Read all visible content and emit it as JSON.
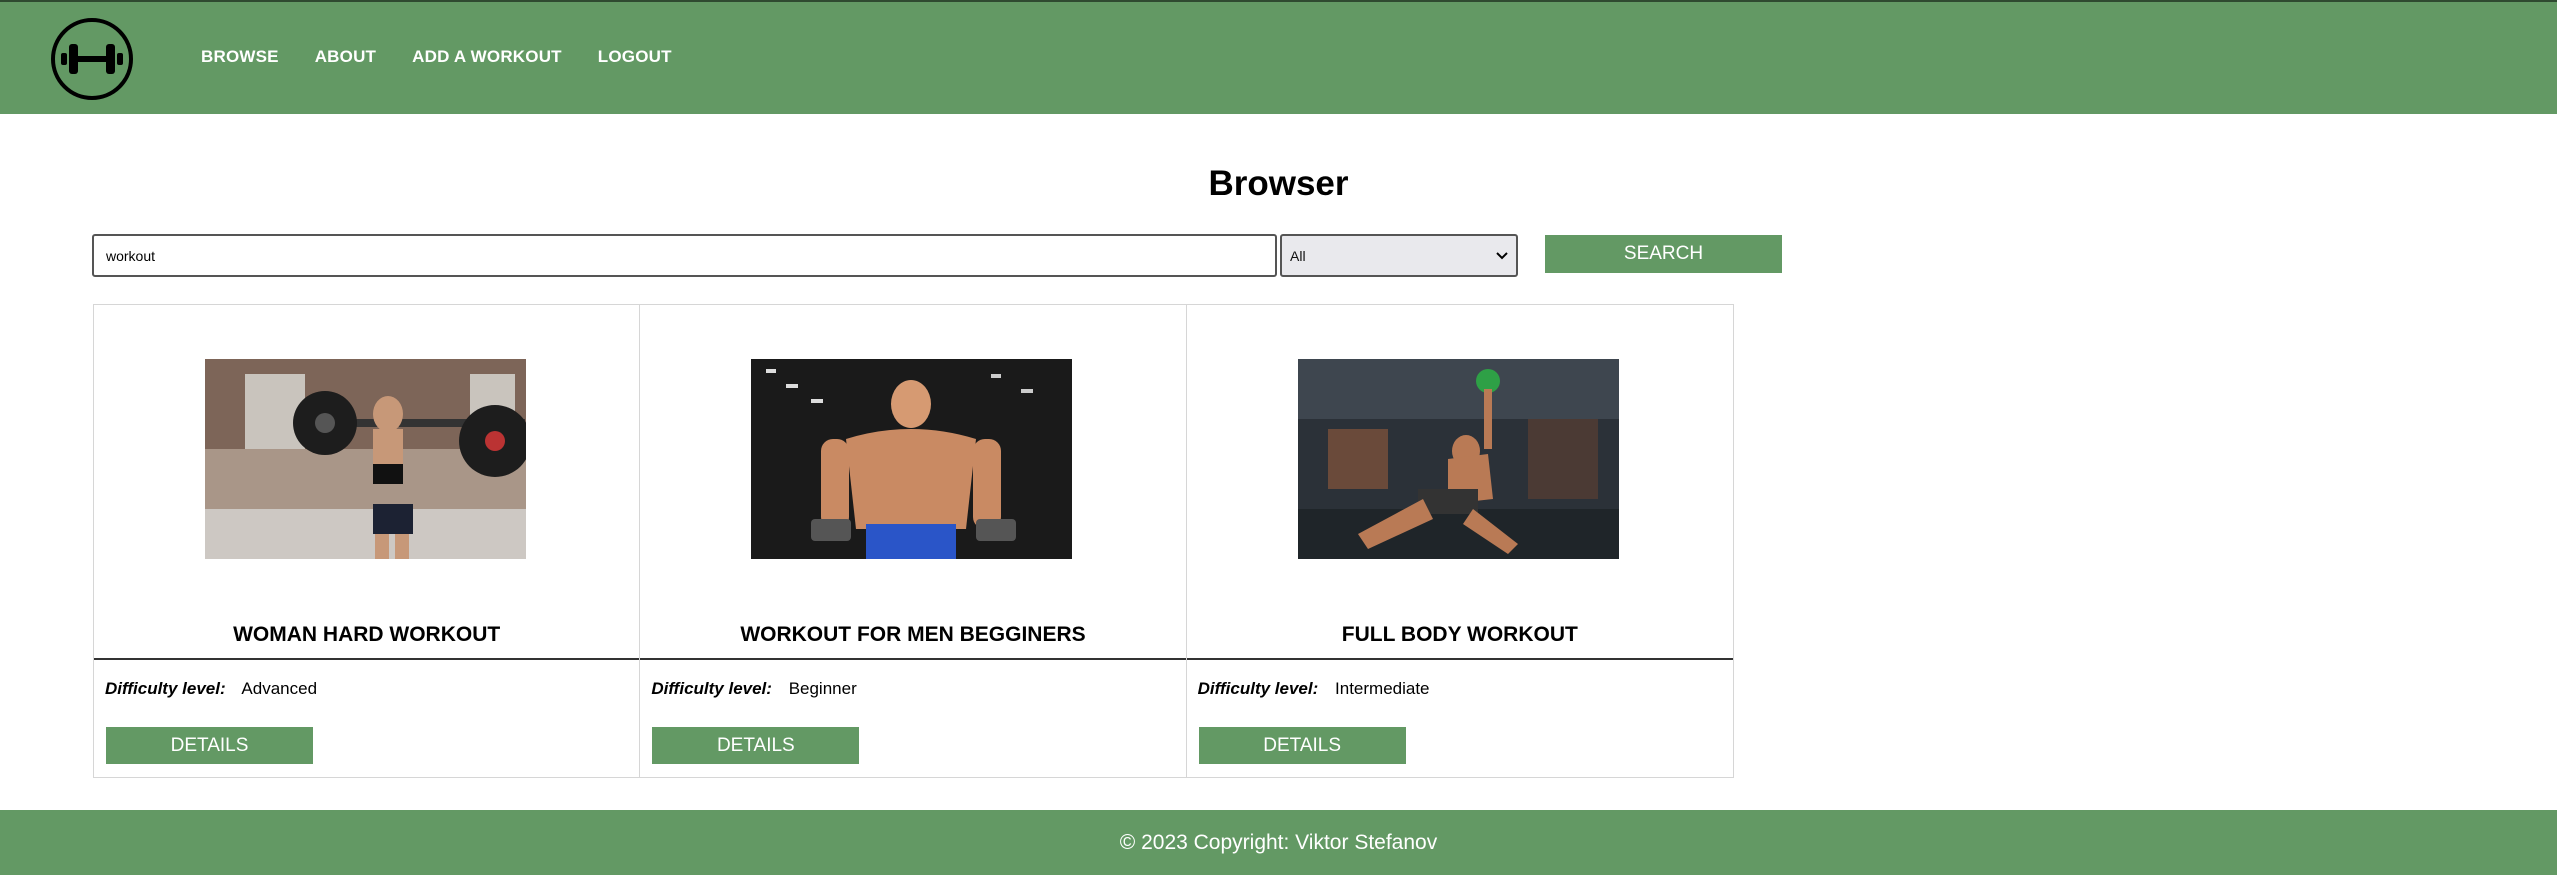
{
  "header": {
    "logo_icon": "dumbbell-icon",
    "nav": [
      "BROWSE",
      "ABOUT",
      "ADD A WORKOUT",
      "LOGOUT"
    ]
  },
  "main": {
    "title": "Browser",
    "search": {
      "value": "workout",
      "placeholder": ""
    },
    "filter": {
      "selected": "All"
    },
    "search_button": "SEARCH"
  },
  "cards": [
    {
      "title": "WOMAN HARD WORKOUT",
      "difficulty_label": "Difficulty level:",
      "difficulty": "Advanced",
      "button": "DETAILS"
    },
    {
      "title": "WORKOUT FOR MEN BEGGINERS",
      "difficulty_label": "Difficulty level:",
      "difficulty": "Beginner",
      "button": "DETAILS"
    },
    {
      "title": "FULL BODY WORKOUT",
      "difficulty_label": "Difficulty level:",
      "difficulty": "Intermediate",
      "button": "DETAILS"
    }
  ],
  "footer": {
    "text": "© 2023 Copyright: Viktor Stefanov"
  },
  "colors": {
    "brand": "#639964",
    "text": "#111111"
  }
}
